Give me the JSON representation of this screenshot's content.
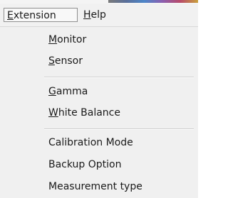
{
  "menubar": {
    "items": [
      {
        "label": "Extension",
        "mnemonic": "E",
        "active": true
      },
      {
        "label": "Help",
        "mnemonic": "H",
        "active": false
      }
    ]
  },
  "menu": {
    "groups": [
      [
        {
          "label": "Monitor",
          "mnemonic": "M"
        },
        {
          "label": "Sensor",
          "mnemonic": "S"
        }
      ],
      [
        {
          "label": "Gamma",
          "mnemonic": "G"
        },
        {
          "label": "White Balance",
          "mnemonic": "W"
        }
      ],
      [
        {
          "label": "Calibration Mode",
          "mnemonic": ""
        },
        {
          "label": "Backup Option",
          "mnemonic": ""
        },
        {
          "label": "Measurement type",
          "mnemonic": ""
        }
      ]
    ]
  }
}
